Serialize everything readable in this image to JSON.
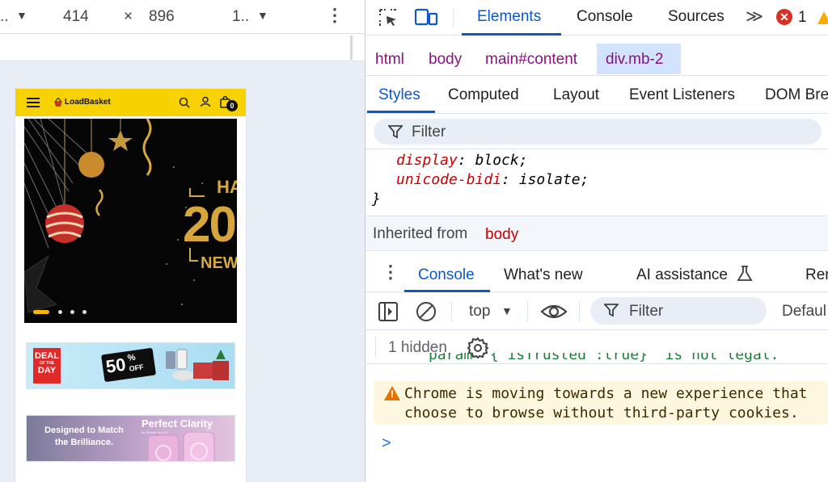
{
  "device_toolbar": {
    "device_label": "..",
    "width": "414",
    "times": "×",
    "height": "896",
    "zoom": "1..",
    "device_dropdown_icon": "triangle-down-icon",
    "zoom_dropdown_icon": "triangle-down-icon",
    "more_icon": "kebab-icon"
  },
  "phone_page": {
    "brand_name": "LoadBasket",
    "cart_count": "0",
    "hero": {
      "year_text": "20",
      "word_fragment": "HA",
      "subtext_fragment": "NEW",
      "carousel_dots": 4,
      "active_dot": 0
    },
    "deal_banner": {
      "badge_line1": "DEAL",
      "badge_line2": "OF THE",
      "badge_line3": "DAY",
      "percent": "50",
      "percent_sign": "%",
      "off_text": "OFF"
    },
    "clarity_banner": {
      "left_line1": "Designed to Match",
      "left_line2": "the Brilliance.",
      "right_title": "Perfect Clarity",
      "right_sub": "for iPhone 16 & 17"
    }
  },
  "devtools": {
    "main_tabs": [
      {
        "label": "Elements",
        "active": true
      },
      {
        "label": "Console",
        "active": false
      },
      {
        "label": "Sources",
        "active": false
      }
    ],
    "more_tabs_label": "≫",
    "error_count": "1",
    "breadcrumbs": [
      {
        "label": "html"
      },
      {
        "label": "body"
      },
      {
        "label": "main#content"
      },
      {
        "label": "div.mb-2",
        "selected": true
      }
    ],
    "styles_tabs": [
      {
        "label": "Styles",
        "active": true
      },
      {
        "label": "Computed"
      },
      {
        "label": "Layout"
      },
      {
        "label": "Event Listeners"
      },
      {
        "label": "DOM Bre"
      }
    ],
    "filter_placeholder": "Filter",
    "css_rules": [
      {
        "prop": "display",
        "value": "block;"
      },
      {
        "prop": "unicode-bidi",
        "value": "isolate;"
      }
    ],
    "closing_brace": "}",
    "inherited_label": "Inherited from",
    "inherited_element": "body",
    "drawer_tabs": [
      {
        "label": "Console",
        "active": true
      },
      {
        "label": "What's new"
      },
      {
        "label": "AI assistance"
      },
      {
        "label": "Rer"
      }
    ],
    "console_context": "top",
    "console_filter": "Filter",
    "default_levels": "Defaul",
    "hidden_count": "1 hidden",
    "clipped_message": "param '{\"isTrusted\":true}' is not legal.",
    "warning_line1": "Chrome is moving towards a new experience that",
    "warning_line2": "choose to browse without third-party cookies.",
    "prompt_symbol": ">",
    "colors": {
      "accent": "#0b57d0",
      "selected_crumb_bg": "#d3e3fd",
      "error_red": "#d93025",
      "warning_bg": "#fef7e0",
      "brand_yellow": "#f8d100"
    }
  }
}
